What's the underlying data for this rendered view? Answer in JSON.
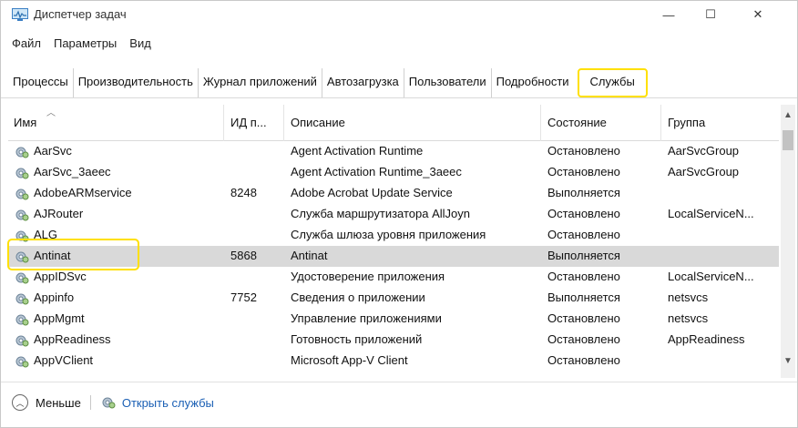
{
  "window": {
    "title": "Диспетчер задач",
    "minimize_glyph": "—",
    "maximize_glyph": "☐",
    "close_glyph": "✕"
  },
  "menu": [
    "Файл",
    "Параметры",
    "Вид"
  ],
  "tabs": [
    "Процессы",
    "Производительность",
    "Журнал приложений",
    "Автозагрузка",
    "Пользователи",
    "Подробности",
    "Службы"
  ],
  "active_tab": "Службы",
  "table": {
    "columns": [
      "Имя",
      "ИД п...",
      "Описание",
      "Состояние",
      "Группа"
    ],
    "rows": [
      {
        "name": "AarSvc",
        "pid": "",
        "desc": "Agent Activation Runtime",
        "state": "Остановлено",
        "group": "AarSvcGroup"
      },
      {
        "name": "AarSvc_3aeec",
        "pid": "",
        "desc": "Agent Activation Runtime_3aeec",
        "state": "Остановлено",
        "group": "AarSvcGroup"
      },
      {
        "name": "AdobeARMservice",
        "pid": "8248",
        "desc": "Adobe Acrobat Update Service",
        "state": "Выполняется",
        "group": ""
      },
      {
        "name": "AJRouter",
        "pid": "",
        "desc": "Служба маршрутизатора AllJoyn",
        "state": "Остановлено",
        "group": "LocalServiceN..."
      },
      {
        "name": "ALG",
        "pid": "",
        "desc": "Служба шлюза уровня приложения",
        "state": "Остановлено",
        "group": ""
      },
      {
        "name": "Antinat",
        "pid": "5868",
        "desc": "Antinat",
        "state": "Выполняется",
        "group": "",
        "selected": true
      },
      {
        "name": "AppIDSvc",
        "pid": "",
        "desc": "Удостоверение приложения",
        "state": "Остановлено",
        "group": "LocalServiceN..."
      },
      {
        "name": "Appinfo",
        "pid": "7752",
        "desc": "Сведения о приложении",
        "state": "Выполняется",
        "group": "netsvcs"
      },
      {
        "name": "AppMgmt",
        "pid": "",
        "desc": "Управление приложениями",
        "state": "Остановлено",
        "group": "netsvcs"
      },
      {
        "name": "AppReadiness",
        "pid": "",
        "desc": "Готовность приложений",
        "state": "Остановлено",
        "group": "AppReadiness"
      },
      {
        "name": "AppVClient",
        "pid": "",
        "desc": "Microsoft App-V Client",
        "state": "Остановлено",
        "group": ""
      }
    ]
  },
  "footer": {
    "less_label": "Меньше",
    "open_services_label": "Открыть службы"
  },
  "colors": {
    "highlight": "#ffe000",
    "selected_row": "#d9d9d9",
    "link": "#1a5fb4"
  },
  "icons": {
    "service": "gear-icon",
    "app": "task-manager-icon",
    "less": "chevron-up-circle-icon"
  }
}
